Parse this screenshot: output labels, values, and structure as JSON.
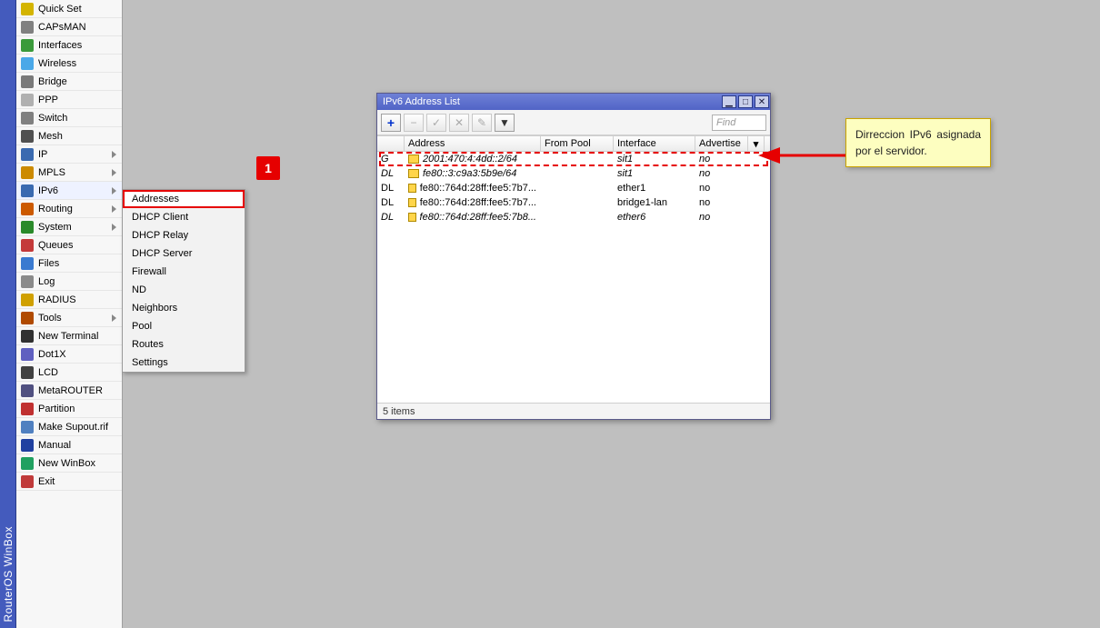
{
  "app_title": "RouterOS WinBox",
  "sidebar": {
    "items": [
      {
        "label": "Quick Set",
        "icon": "#d4b400",
        "arrow": false
      },
      {
        "label": "CAPsMAN",
        "icon": "#808080",
        "arrow": false
      },
      {
        "label": "Interfaces",
        "icon": "#3a9a3a",
        "arrow": false
      },
      {
        "label": "Wireless",
        "icon": "#4aa8e8",
        "arrow": false
      },
      {
        "label": "Bridge",
        "icon": "#7a7a7a",
        "arrow": false
      },
      {
        "label": "PPP",
        "icon": "#b0b0b0",
        "arrow": false
      },
      {
        "label": "Switch",
        "icon": "#808080",
        "arrow": false
      },
      {
        "label": "Mesh",
        "icon": "#505050",
        "arrow": false
      },
      {
        "label": "IP",
        "icon": "#3a6ab0",
        "arrow": true
      },
      {
        "label": "MPLS",
        "icon": "#cc8a00",
        "arrow": true
      },
      {
        "label": "IPv6",
        "icon": "#3a6ab0",
        "arrow": true,
        "open": true
      },
      {
        "label": "Routing",
        "icon": "#cc5a00",
        "arrow": true
      },
      {
        "label": "System",
        "icon": "#2a8a2a",
        "arrow": true
      },
      {
        "label": "Queues",
        "icon": "#c43a3a",
        "arrow": false
      },
      {
        "label": "Files",
        "icon": "#3a7ad0",
        "arrow": false
      },
      {
        "label": "Log",
        "icon": "#8a8a8a",
        "arrow": false
      },
      {
        "label": "RADIUS",
        "icon": "#d0a000",
        "arrow": false
      },
      {
        "label": "Tools",
        "icon": "#b04a00",
        "arrow": true
      },
      {
        "label": "New Terminal",
        "icon": "#303030",
        "arrow": false
      },
      {
        "label": "Dot1X",
        "icon": "#6060c0",
        "arrow": false
      },
      {
        "label": "LCD",
        "icon": "#404040",
        "arrow": false
      },
      {
        "label": "MetaROUTER",
        "icon": "#505080",
        "arrow": false
      },
      {
        "label": "Partition",
        "icon": "#c03030",
        "arrow": false
      },
      {
        "label": "Make Supout.rif",
        "icon": "#5080c0",
        "arrow": false
      },
      {
        "label": "Manual",
        "icon": "#2040a0",
        "arrow": false
      },
      {
        "label": "New WinBox",
        "icon": "#20a060",
        "arrow": false
      },
      {
        "label": "Exit",
        "icon": "#c03a3a",
        "arrow": false
      }
    ]
  },
  "submenu": {
    "items": [
      {
        "label": "Addresses",
        "highlight": true
      },
      {
        "label": "DHCP Client"
      },
      {
        "label": "DHCP Relay"
      },
      {
        "label": "DHCP Server"
      },
      {
        "label": "Firewall"
      },
      {
        "label": "ND"
      },
      {
        "label": "Neighbors"
      },
      {
        "label": "Pool"
      },
      {
        "label": "Routes"
      },
      {
        "label": "Settings"
      }
    ]
  },
  "callout1": "1",
  "window": {
    "title": "IPv6 Address List",
    "find_placeholder": "Find",
    "columns": {
      "address": "Address",
      "from_pool": "From Pool",
      "interface": "Interface",
      "advertise": "Advertise"
    },
    "rows": [
      {
        "flag": "G",
        "address": "2001:470:4:4dd::2/64",
        "from_pool": "",
        "interface": "sit1",
        "advertise": "no",
        "italic": true,
        "highlight": true
      },
      {
        "flag": "DL",
        "address": "fe80::3:c9a3:5b9e/64",
        "from_pool": "",
        "interface": "sit1",
        "advertise": "no",
        "italic": true
      },
      {
        "flag": "DL",
        "address": "fe80::764d:28ff:fee5:7b7...",
        "from_pool": "",
        "interface": "ether1",
        "advertise": "no"
      },
      {
        "flag": "DL",
        "address": "fe80::764d:28ff:fee5:7b7...",
        "from_pool": "",
        "interface": "bridge1-lan",
        "advertise": "no"
      },
      {
        "flag": "DL",
        "address": "fe80::764d:28ff:fee5:7b8...",
        "from_pool": "",
        "interface": "ether6",
        "advertise": "no",
        "italic": true
      }
    ],
    "status": "5 items"
  },
  "note": {
    "text": "Dirreccion IPv6 asignada por el servidor."
  }
}
